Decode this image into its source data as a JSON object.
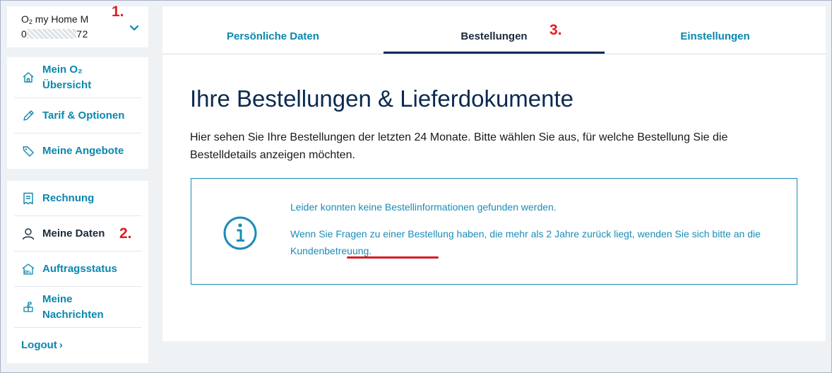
{
  "account": {
    "name_prefix": "O",
    "name_sub": "2",
    "name_rest": " my Home M",
    "number_start": "0",
    "number_end": "72"
  },
  "sidebar": {
    "group1": [
      {
        "label_line1": "Mein O₂",
        "label_line2": "Übersicht",
        "icon": "home-icon"
      },
      {
        "label": "Tarif & Optionen",
        "icon": "pencil-icon"
      },
      {
        "label": "Meine Angebote",
        "icon": "tag-icon"
      }
    ],
    "group2": [
      {
        "label": "Rechnung",
        "icon": "invoice-icon"
      },
      {
        "label": "Meine Daten",
        "icon": "user-icon",
        "active": true
      },
      {
        "label": "Auftragsstatus",
        "icon": "dsl-house-icon"
      },
      {
        "label_line1": "Meine",
        "label_line2": "Nachrichten",
        "icon": "mailbox-icon"
      }
    ],
    "logout": "Logout",
    "logout_arrow": "›"
  },
  "markers": {
    "m1": "1.",
    "m2": "2.",
    "m3": "3."
  },
  "tabs": [
    {
      "label": "Persönliche Daten"
    },
    {
      "label": "Bestellungen",
      "active": true
    },
    {
      "label": "Einstellungen"
    }
  ],
  "main": {
    "title": "Ihre Bestellungen & Lieferdokumente",
    "intro": "Hier sehen Sie Ihre Bestellungen der letzten 24 Monate. Bitte wählen Sie aus, für welche Bestellung Sie die Bestelldetails anzeigen möchten.",
    "info": {
      "line1": "Leider konnten keine Bestellinformationen gefunden werden.",
      "line2_before": "Wenn Sie Fragen zu einer Bestellung haben, die mehr als 2 Jahre zurück liegt, wenden Sie sich bitte an die ",
      "link": "Kundenbetreuung",
      "line2_after": "."
    }
  },
  "colors": {
    "accent": "#0a87ae",
    "navy": "#0b2a50",
    "marker_red": "#e11b22"
  }
}
